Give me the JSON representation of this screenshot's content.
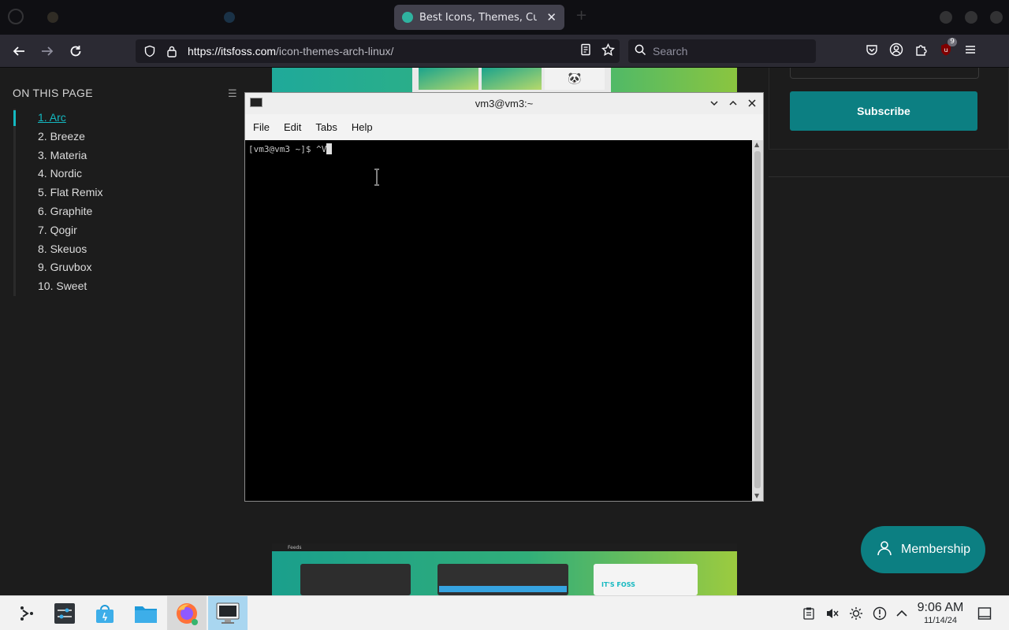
{
  "browser": {
    "tabs": [
      {
        "title": "",
        "active": false,
        "favicon_color": "#8a7a55"
      },
      {
        "title": "",
        "active": false,
        "favicon_color": "#3a8fd0"
      },
      {
        "title": "Best Icons, Themes, Curso",
        "active": true,
        "favicon_color": "#2fb3a0"
      }
    ],
    "tab_close_glyph": "✕",
    "url_host": "https://itsfoss.com",
    "url_path": "/icon-themes-arch-linux/",
    "search_placeholder": "Search",
    "extension_badge": "9"
  },
  "page": {
    "toc_title": "ON THIS PAGE",
    "toc_items": [
      "1. Arc",
      "2. Breeze",
      "3. Materia",
      "4. Nordic",
      "5. Flat Remix",
      "6. Graphite",
      "7. Qogir",
      "8. Skeuos",
      "9. Gruvbox",
      "10. Sweet"
    ],
    "toc_active_index": 0,
    "subscribe_label": "Subscribe",
    "membership_label": "Membership",
    "hero_bottom_caption": "Feeds",
    "hero_bottom_logo": "IT'S FOSS",
    "accent_color": "#0c7f82"
  },
  "terminal": {
    "title": "vm3@vm3:~",
    "menu": [
      "File",
      "Edit",
      "Tabs",
      "Help"
    ],
    "prompt": "[vm3@vm3 ~]$ ^V"
  },
  "taskbar": {
    "time": "9:06 AM",
    "date": "11/14/24"
  }
}
